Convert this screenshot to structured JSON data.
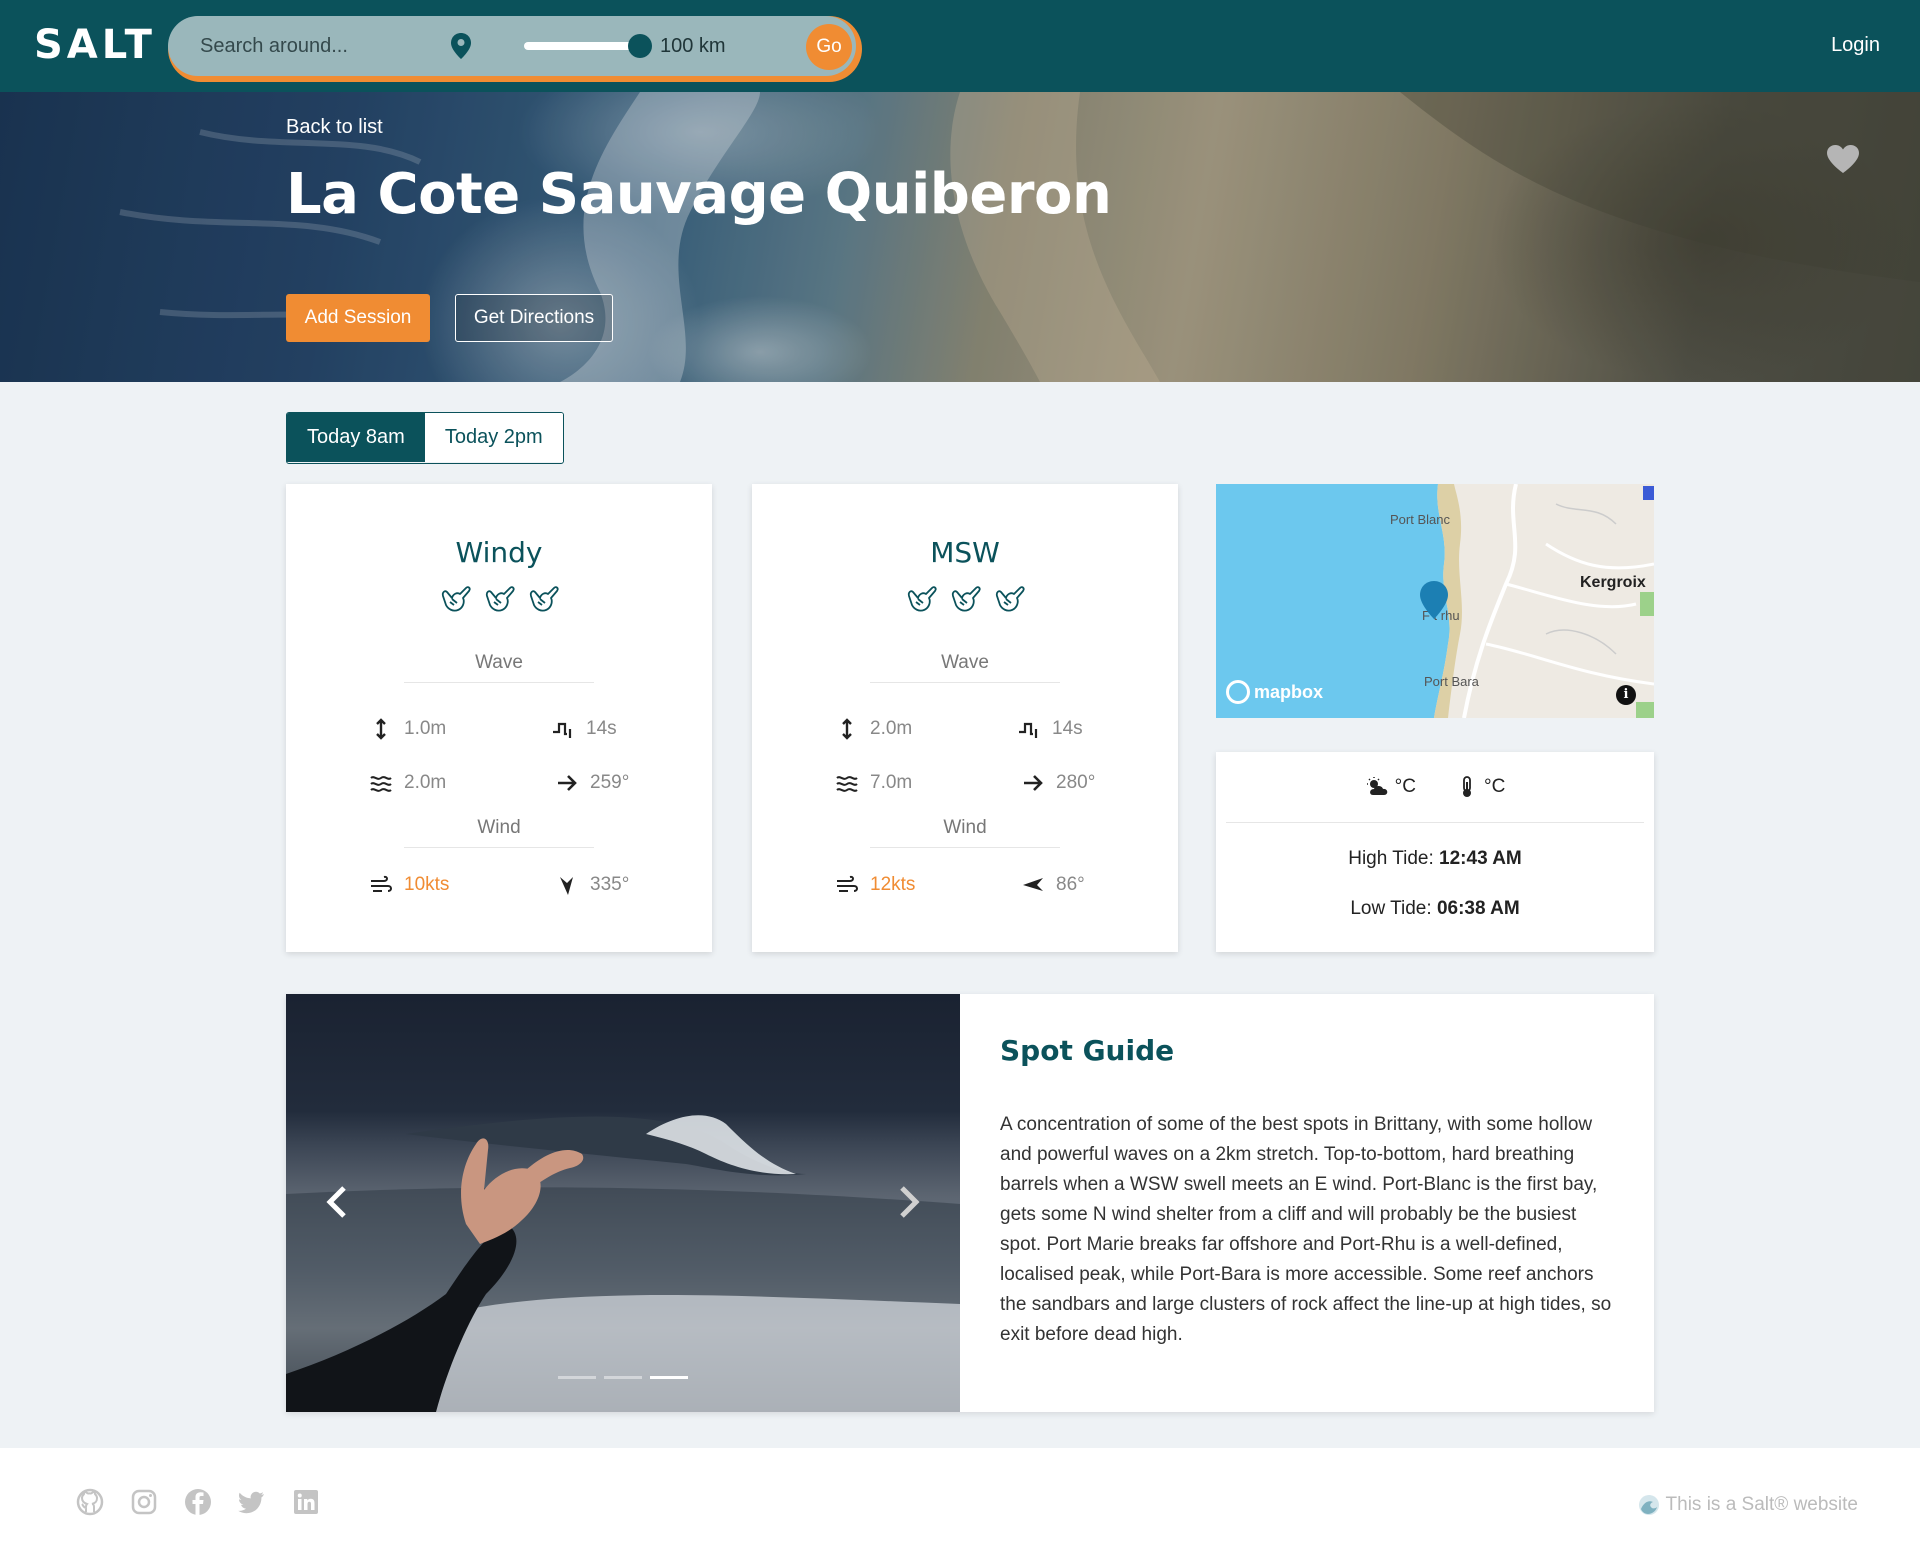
{
  "header": {
    "logo": "SALT",
    "search_placeholder": "Search around...",
    "radius_value": 100,
    "radius_label": "100 km",
    "go_label": "Go",
    "login_label": "Login",
    "colors": {
      "bar": "#0b525b",
      "accent": "#f08c33"
    }
  },
  "hero": {
    "back_label": "Back to list",
    "title": "La Cote Sauvage Quiberon",
    "add_session_label": "Add Session",
    "directions_label": "Get Directions",
    "favorite_icon": "heart-icon"
  },
  "tabs": [
    {
      "label": "Today 8am",
      "active": true
    },
    {
      "label": "Today 2pm",
      "active": false
    }
  ],
  "forecasts": [
    {
      "source": "Windy",
      "rating": 3,
      "wave_label": "Wave",
      "height": "1.0m",
      "period": "14s",
      "swell": "2.0m",
      "direction": "259°",
      "wind_label": "Wind",
      "wind_speed": "10kts",
      "wind_direction": "335°"
    },
    {
      "source": "MSW",
      "rating": 3,
      "wave_label": "Wave",
      "height": "2.0m",
      "period": "14s",
      "swell": "7.0m",
      "direction": "280°",
      "wind_label": "Wind",
      "wind_speed": "12kts",
      "wind_direction": "86°"
    }
  ],
  "map": {
    "labels": {
      "port_blanc": "Port Blanc",
      "port_rhu": "F   t rhu",
      "port_bara": "Port Bara",
      "kergroix": "Kergroix"
    },
    "brand": "mapbox",
    "info": "i"
  },
  "conditions": {
    "air_unit": "°C",
    "water_unit": "°C",
    "high_tide_label": "High Tide:",
    "high_tide_time": "12:43 AM",
    "low_tide_label": "Low Tide:",
    "low_tide_time": "06:38 AM"
  },
  "guide": {
    "title": "Spot Guide",
    "text": "A concentration of some of the best spots in Brittany, with some hollow and powerful waves on a 2km stretch. Top-to-bottom, hard breathing barrels when a WSW swell meets an E wind. Port-Blanc is the first bay, gets some N wind shelter from a cliff and will probably be the busiest spot. Port Marie breaks far offshore and Port-Rhu is a well-defined, localised peak, while Port-Bara is more accessible. Some reef anchors the sandbars and large clusters of rock affect the line-up at high tides, so exit before dead high.",
    "slides": 3,
    "active_slide": 3
  },
  "footer": {
    "social_icons": [
      "github-icon",
      "instagram-icon",
      "facebook-icon",
      "twitter-icon",
      "linkedin-icon"
    ],
    "credit": "This is a Salt® website"
  }
}
